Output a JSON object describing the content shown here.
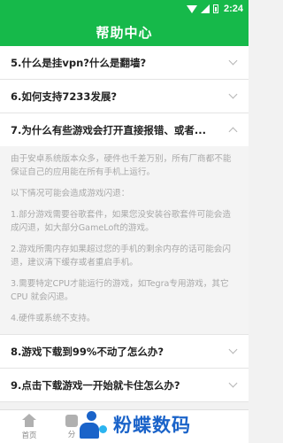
{
  "status_bar": {
    "time": "2:24",
    "icons": [
      "wifi-icon",
      "signal-icon",
      "battery-icon"
    ]
  },
  "header": {
    "title": "帮助中心"
  },
  "faq": [
    {
      "question": "5.什么是挂vpn?什么是翻墙?",
      "expanded": false
    },
    {
      "question": "6.如何支持7233发展?",
      "expanded": false
    },
    {
      "question": "7.为什么有些游戏会打开直接报错、或者...",
      "expanded": true,
      "answer": [
        "由于安卓系统版本众多，硬件也千差万别，所有厂商都不能保证自己的应用能在所有手机上运行。",
        "以下情况可能会造成游戏闪退：",
        "1.部分游戏需要谷歌套件，如果您没安装谷歌套件可能会造成闪退，如大部分GameLoft的游戏。",
        "2.游戏所需内存如果超过您的手机的剩余内存的话可能会闪退，建议清下缓存或者重启手机。",
        "3.需要特定CPU才能运行的游戏，如Tegra专用游戏，其它CPU 就会闪退。",
        "4.硬件或系统不支持。"
      ]
    },
    {
      "question": "8.游戏下载到99%不动了怎么办?",
      "expanded": false
    },
    {
      "question": "9.点击下载游戏一开始就卡住怎么办?",
      "expanded": false
    }
  ],
  "bottom_nav": [
    {
      "label": "首页",
      "icon": "home-icon"
    },
    {
      "label": "分",
      "icon": "category-icon"
    }
  ],
  "watermark": {
    "text": "粉蝶数码",
    "icon": "fendie-logo"
  },
  "colors": {
    "primary_green": "#16b94a",
    "watermark_blue": "#1a63c9"
  }
}
